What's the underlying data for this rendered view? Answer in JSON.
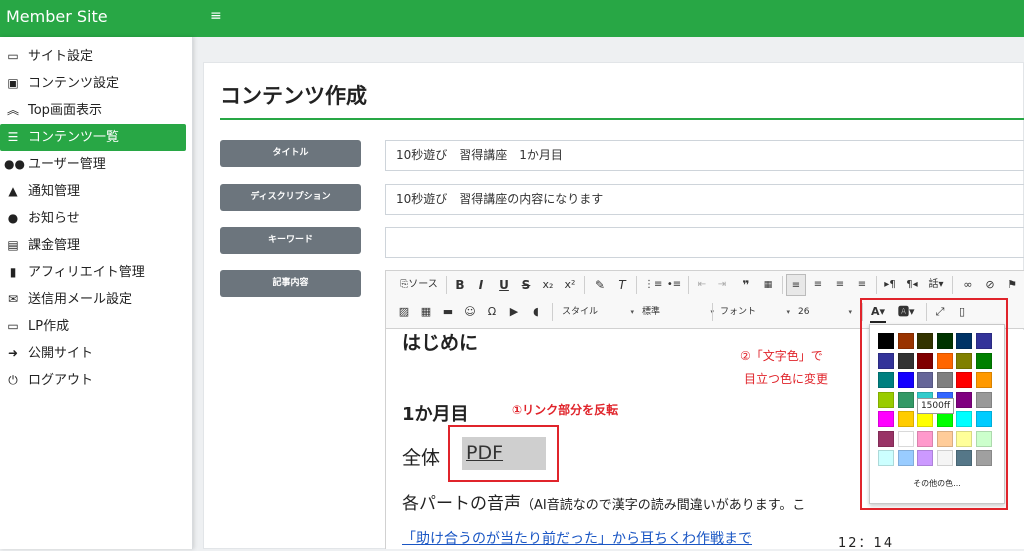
{
  "app": {
    "brand": "Member Site",
    "menu_icon": "≡"
  },
  "sidebar": {
    "items": [
      {
        "label": "サイト設定",
        "icon": "id-card-icon"
      },
      {
        "label": "コンテンツ設定",
        "icon": "folder-plus-icon"
      },
      {
        "label": "Top画面表示",
        "icon": "chevrons-up-icon"
      },
      {
        "label": "コンテンツ一覧",
        "icon": "list-check-icon",
        "active": true
      },
      {
        "label": "ユーザー管理",
        "icon": "users-icon"
      },
      {
        "label": "通知管理",
        "icon": "bell-icon"
      },
      {
        "label": "お知らせ",
        "icon": "comment-icon"
      },
      {
        "label": "課金管理",
        "icon": "money-bill-icon"
      },
      {
        "label": "アフィリエイト管理",
        "icon": "file-text-icon"
      },
      {
        "label": "送信用メール設定",
        "icon": "envelope-icon"
      },
      {
        "label": "LP作成",
        "icon": "desktop-icon"
      },
      {
        "label": "公開サイト",
        "icon": "arrow-circle-right-icon"
      },
      {
        "label": "ログアウト",
        "icon": "power-icon"
      }
    ]
  },
  "page": {
    "title": "コンテンツ作成"
  },
  "form": {
    "title_label": "タイトル",
    "title_value": "10秒遊び　習得講座　1か月目",
    "description_label": "ディスクリプション",
    "description_value": "10秒遊び　習得講座の内容になります",
    "keyword_label": "キーワード",
    "keyword_value": "",
    "body_label": "記事内容"
  },
  "toolbar": {
    "source": "ソース",
    "bold": "B",
    "italic": "I",
    "underline": "U",
    "strike": "S",
    "subscript": "x₂",
    "superscript": "x²",
    "style_label": "スタイル",
    "format_label": "標準",
    "font_label": "フォント",
    "size_label": "26"
  },
  "content": {
    "heading": "はじめに",
    "month_heading": "1か月目",
    "zentai": "全体",
    "pdf_link": "PDF",
    "parts_heading": "各パートの音声",
    "parts_note": "（AI音読なので漢字の読み間違いがあります。こ",
    "link2": "「助け合うのが当たり前だった」から耳ちくわ作戦まで",
    "time": "12：14"
  },
  "annotations": {
    "step1": "①リンク部分を反転",
    "step2_line1": "②「文字色」で",
    "step2_line2": "目立つ色に変更"
  },
  "palette": {
    "tooltip": "1500ff",
    "more_colors": "その他の色...",
    "colors": [
      [
        "#000000",
        "#993300",
        "#333300",
        "#003300",
        "#003366",
        "#333399"
      ],
      [
        "#333399",
        "#333333",
        "#800000",
        "#ff6600",
        "#808000",
        "#008000"
      ],
      [
        "#008080",
        "#1500ff",
        "#666699",
        "#808080",
        "#ff0000",
        "#ff9900"
      ],
      [
        "#99cc00",
        "#339966",
        "#33cccc",
        "#3366ff",
        "#800080",
        "#999999"
      ],
      [
        "#ff00ff",
        "#ffcc00",
        "#ffff00",
        "#00ff00",
        "#00ffff",
        "#00ccff"
      ],
      [
        "#993366",
        "#ffffff",
        "#ff99cc",
        "#ffcc99",
        "#ffff99",
        "#ccffcc"
      ],
      [
        "#ccffff",
        "#99ccff",
        "#cc99ff",
        "#f5f5f5",
        "#557788",
        "#a0a0a0"
      ]
    ]
  },
  "colors": {
    "accent": "#28a745",
    "annotation": "#e0242b",
    "label_bg": "#6c757d"
  }
}
